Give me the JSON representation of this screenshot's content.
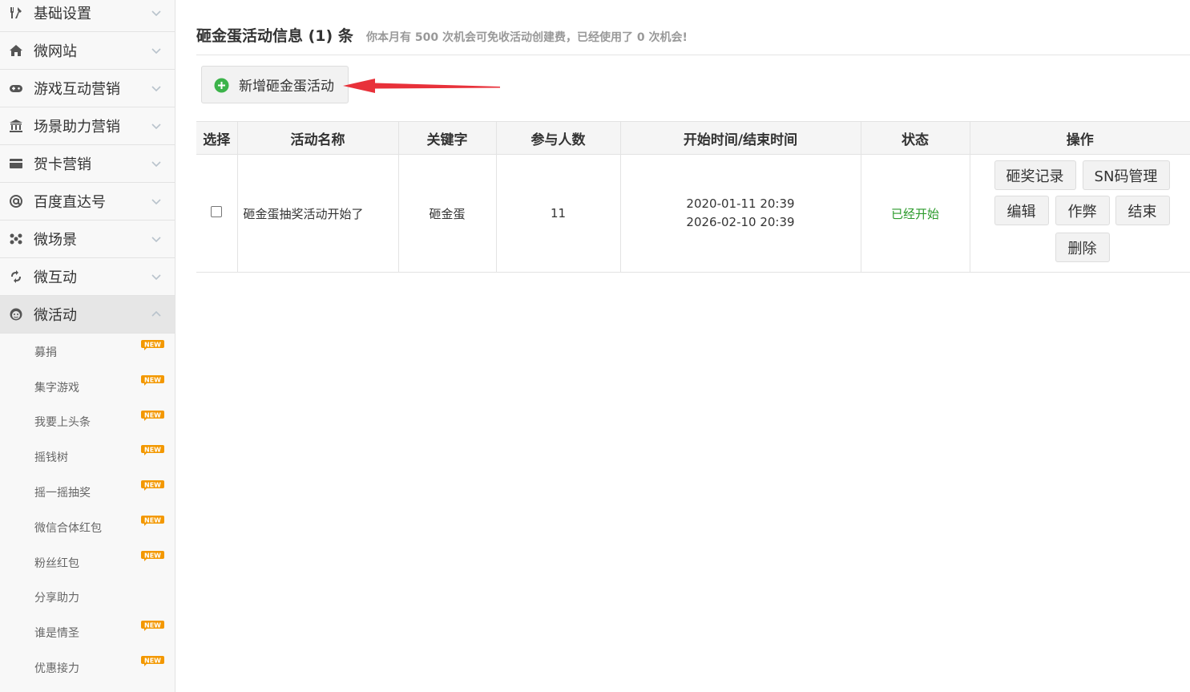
{
  "sidebar": {
    "menus": [
      {
        "label": "基础设置",
        "icon": "tools-icon"
      },
      {
        "label": "微网站",
        "icon": "home-icon"
      },
      {
        "label": "游戏互动营销",
        "icon": "gamepad-icon"
      },
      {
        "label": "场景助力营销",
        "icon": "bank-icon"
      },
      {
        "label": "贺卡营销",
        "icon": "card-icon"
      },
      {
        "label": "百度直达号",
        "icon": "at-icon"
      },
      {
        "label": "微场景",
        "icon": "nodes-icon"
      },
      {
        "label": "微互动",
        "icon": "sync-icon"
      },
      {
        "label": "微活动",
        "icon": "mascot-icon"
      }
    ],
    "submenu": [
      {
        "label": "募捐",
        "new": true
      },
      {
        "label": "集字游戏",
        "new": true
      },
      {
        "label": "我要上头条",
        "new": true
      },
      {
        "label": "摇钱树",
        "new": true
      },
      {
        "label": "摇一摇抽奖",
        "new": true
      },
      {
        "label": "微信合体红包",
        "new": true
      },
      {
        "label": "粉丝红包",
        "new": true
      },
      {
        "label": "分享助力",
        "new": false
      },
      {
        "label": "谁是情圣",
        "new": true
      },
      {
        "label": "优惠接力",
        "new": true
      }
    ],
    "new_badge_text": "NEW"
  },
  "page": {
    "title": "砸金蛋活动信息 (1) 条",
    "subtitle": "你本月有 500 次机会可免收活动创建费，已经使用了 0 次机会!",
    "add_button": "新增砸金蛋活动"
  },
  "table": {
    "headers": [
      "选择",
      "活动名称",
      "关键字",
      "参与人数",
      "开始时间/结束时间",
      "状态",
      "操作"
    ],
    "rows": [
      {
        "name": "砸金蛋抽奖活动开始了",
        "keyword": "砸金蛋",
        "participants": "11",
        "start_time": "2020-01-11 20:39",
        "end_time": "2026-02-10 20:39",
        "status": "已经开始",
        "actions": {
          "records": "砸奖记录",
          "sn": "SN码管理",
          "edit": "编辑",
          "cheat": "作弊",
          "end": "结束",
          "delete": "删除"
        }
      }
    ]
  },
  "colors": {
    "status_green": "#2b9a2b",
    "arrow_red": "#e8313a",
    "badge_orange": "#f39800",
    "add_icon_green": "#3cb34a"
  }
}
